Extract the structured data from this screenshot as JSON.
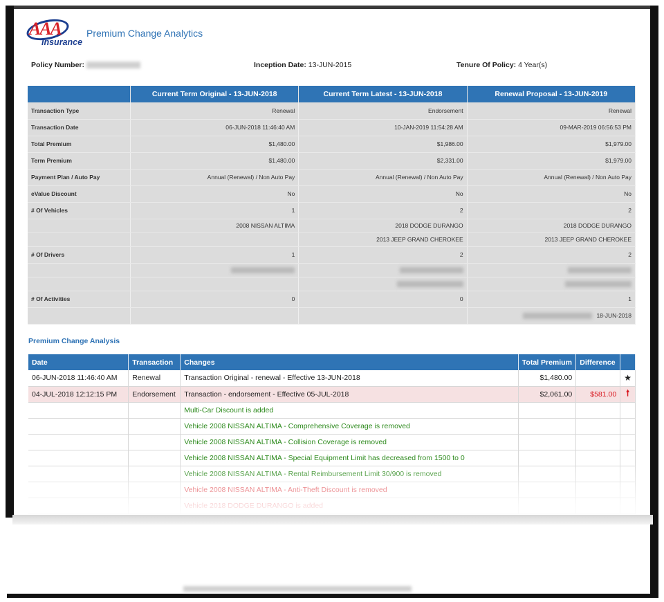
{
  "header": {
    "logo_text": "AAA",
    "logo_subtext": "Insurance",
    "app_title": "Premium Change Analytics"
  },
  "policy": {
    "policy_number_label": "Policy Number:",
    "inception_label": "Inception Date:",
    "inception_value": "13-JUN-2015",
    "tenure_label": "Tenure Of Policy:",
    "tenure_value": "4 Year(s)"
  },
  "summary": {
    "columns": [
      "Current Term Original - 13-JUN-2018",
      "Current Term Latest - 13-JUN-2018",
      "Renewal Proposal - 13-JUN-2019"
    ],
    "rows": [
      {
        "label": "Transaction Type",
        "values": [
          "Renewal",
          "Endorsement",
          "Renewal"
        ]
      },
      {
        "label": "Transaction Date",
        "values": [
          "06-JUN-2018 11:46:40 AM",
          "10-JAN-2019 11:54:28 AM",
          "09-MAR-2019 06:56:53 PM"
        ]
      },
      {
        "label": "Total Premium",
        "values": [
          "$1,480.00",
          "$1,986.00",
          "$1,979.00"
        ]
      },
      {
        "label": "Term Premium",
        "values": [
          "$1,480.00",
          "$2,331.00",
          "$1,979.00"
        ]
      },
      {
        "label": "Payment Plan / Auto Pay",
        "values": [
          "Annual (Renewal) / Non Auto Pay",
          "Annual (Renewal) / Non Auto Pay",
          "Annual (Renewal) / Non Auto Pay"
        ]
      },
      {
        "label": "eValue Discount",
        "values": [
          "No",
          "No",
          "No"
        ]
      },
      {
        "label": "# Of Vehicles",
        "values": [
          "1",
          "2",
          "2"
        ]
      },
      {
        "label": "",
        "values": [
          "2008 NISSAN ALTIMA",
          "2018 DODGE DURANGO",
          "2018 DODGE DURANGO"
        ]
      },
      {
        "label": "",
        "values": [
          "",
          "2013 JEEP GRAND CHEROKEE",
          "2013 JEEP GRAND CHEROKEE"
        ]
      },
      {
        "label": "# Of Drivers",
        "values": [
          "1",
          "2",
          "2"
        ]
      },
      {
        "label": "# Of Activities",
        "values": [
          "0",
          "0",
          "1"
        ]
      },
      {
        "label": "",
        "values": [
          "",
          "",
          "18-JUN-2018"
        ]
      }
    ]
  },
  "analysis": {
    "section_title": "Premium Change Analysis",
    "headers": [
      "Date",
      "Transaction",
      "Changes",
      "Total Premium",
      "Difference"
    ],
    "rows": [
      {
        "date": "06-JUN-2018 11:46:40 AM",
        "transaction": "Renewal",
        "change": "Transaction Original - renewal - Effective 13-JUN-2018",
        "total": "$1,480.00",
        "diff": "",
        "marker": "★",
        "style": "normal"
      },
      {
        "date": "04-JUL-2018 12:12:15 PM",
        "transaction": "Endorsement",
        "change": "Transaction - endorsement - Effective 05-JUL-2018",
        "total": "$2,061.00",
        "diff": "$581.00",
        "marker": "🠕",
        "style": "highlight"
      },
      {
        "date": "",
        "transaction": "",
        "change": "Multi-Car Discount is added",
        "total": "",
        "diff": "",
        "marker": "",
        "style": "green"
      },
      {
        "date": "",
        "transaction": "",
        "change": "Vehicle 2008 NISSAN ALTIMA - Comprehensive Coverage is removed",
        "total": "",
        "diff": "",
        "marker": "",
        "style": "green"
      },
      {
        "date": "",
        "transaction": "",
        "change": "Vehicle 2008 NISSAN ALTIMA - Collision Coverage is removed",
        "total": "",
        "diff": "",
        "marker": "",
        "style": "green"
      },
      {
        "date": "",
        "transaction": "",
        "change": "Vehicle 2008 NISSAN ALTIMA - Special Equipment Limit has decreased from 1500 to 0",
        "total": "",
        "diff": "",
        "marker": "",
        "style": "green"
      },
      {
        "date": "",
        "transaction": "",
        "change": "Vehicle 2008 NISSAN ALTIMA - Rental Reimbursement Limit 30/900 is removed",
        "total": "",
        "diff": "",
        "marker": "",
        "style": "green"
      },
      {
        "date": "",
        "transaction": "",
        "change": "Vehicle 2008 NISSAN ALTIMA - Anti-Theft Discount is removed",
        "total": "",
        "diff": "",
        "marker": "",
        "style": "red"
      },
      {
        "date": "",
        "transaction": "",
        "change": "Vehicle 2018 DODGE DURANGO is added",
        "total": "",
        "diff": "",
        "marker": "",
        "style": "red"
      }
    ]
  },
  "colors": {
    "header_blue": "#2f74b5",
    "title_blue": "#2f73b5",
    "logo_red": "#d8232a",
    "logo_navy": "#1a3d8f",
    "positive_green": "#2d8a1d",
    "negative_red": "#d8141c",
    "highlight_row": "#f6e1e2"
  }
}
